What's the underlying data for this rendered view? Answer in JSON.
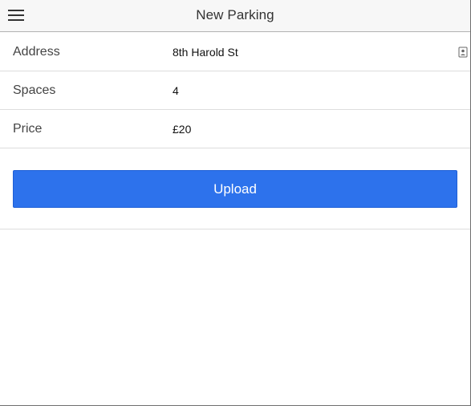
{
  "navbar": {
    "title": "New Parking",
    "menu_icon": "hamburger-menu-icon"
  },
  "form": {
    "fields": [
      {
        "label": "Address",
        "value": "8th Harold St",
        "accessory_icon": "contact-card-icon"
      },
      {
        "label": "Spaces",
        "value": "4"
      },
      {
        "label": "Price",
        "value": "£20"
      }
    ],
    "submit_label": "Upload"
  },
  "colors": {
    "accent": "#2d72ec",
    "navbar_bg": "#f7f7f7",
    "divider": "#dddddd"
  }
}
